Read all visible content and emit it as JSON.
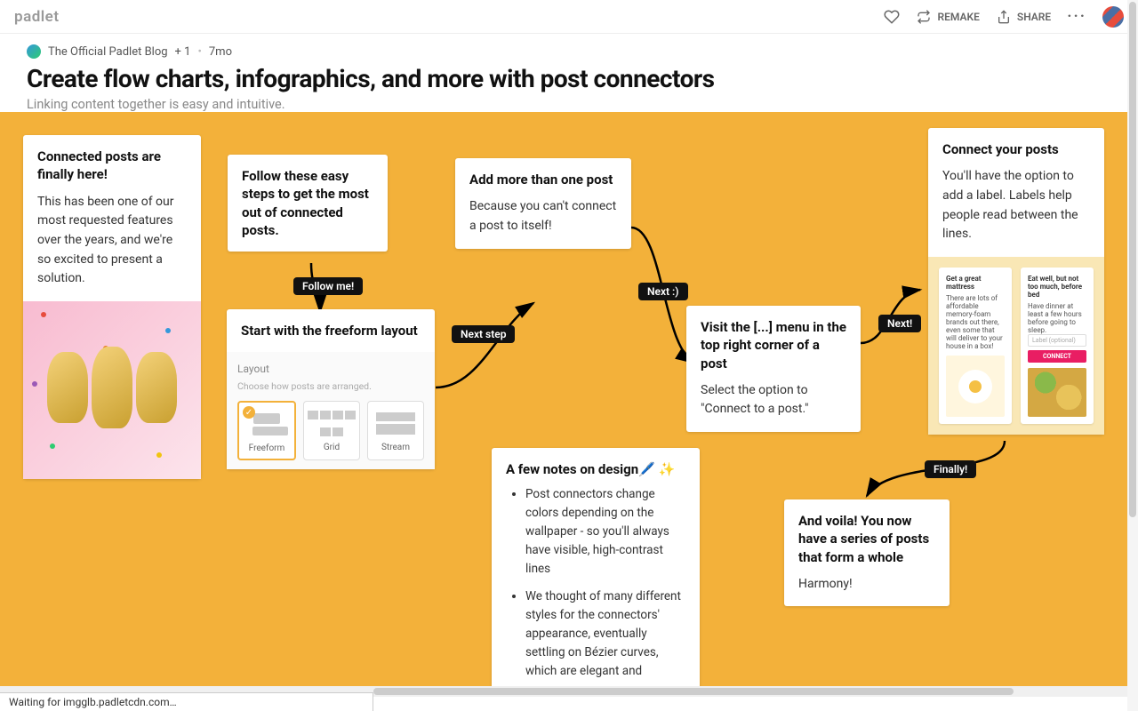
{
  "brand": "padlet",
  "topbar": {
    "remake": "REMAKE",
    "share": "SHARE"
  },
  "header": {
    "author": "The Official Padlet Blog",
    "plus": "+ 1",
    "time": "7mo",
    "title": "Create flow charts, infographics, and more with post connectors",
    "subtitle": "Linking content together is easy and intuitive."
  },
  "cards": {
    "c1_title": "Connected posts are finally here!",
    "c1_body": "This has been one of our most requested features over the years, and we're so excited to present a solution.",
    "c2_title": "Follow these easy steps to get the most out of connected posts.",
    "c3_title": "Start with the freeform layout",
    "c4_title": "Add more than one post",
    "c4_body": "Because you can't connect a post to itself!",
    "c5_title": "Visit the [...] menu in the top right corner of a post",
    "c5_body": "Select the option to \"Connect to a post.\"",
    "c6_title": "Connect your posts",
    "c6_body": "You'll have the option to add a label. Labels help people read between the lines.",
    "c7_title": "And voila! You now have a series of posts that form a whole",
    "c7_body": "Harmony!",
    "c8_title": "A few notes on design🖊️ ✨",
    "c8_note1": "Post connectors change colors depending on the wallpaper - so you'll always have visible, high-contrast lines",
    "c8_note2": "We thought of many different styles for the connectors' appearance, eventually settling on Bézier curves, which are elegant and"
  },
  "labels": {
    "l1": "Follow me!",
    "l2": "Next step",
    "l3": "Next :)",
    "l4": "Next!",
    "l5": "Finally!"
  },
  "layout_preview": {
    "head": "Layout",
    "sub": "Choose how posts are arranged.",
    "opt1": "Freeform",
    "opt2": "Grid",
    "opt3": "Stream"
  },
  "connect_preview": {
    "left_title": "Get a great mattress",
    "left_body": "There are lots of affordable memory-foam brands out there, even some that will deliver to your house in a box!",
    "right_title": "Eat well, but not too much, before bed",
    "right_body": "Have dinner at least a few hours before going to sleep.",
    "input_ph": "Label (optional)",
    "btn": "CONNECT"
  },
  "status": "Waiting for imgglb.padletcdn.com…"
}
